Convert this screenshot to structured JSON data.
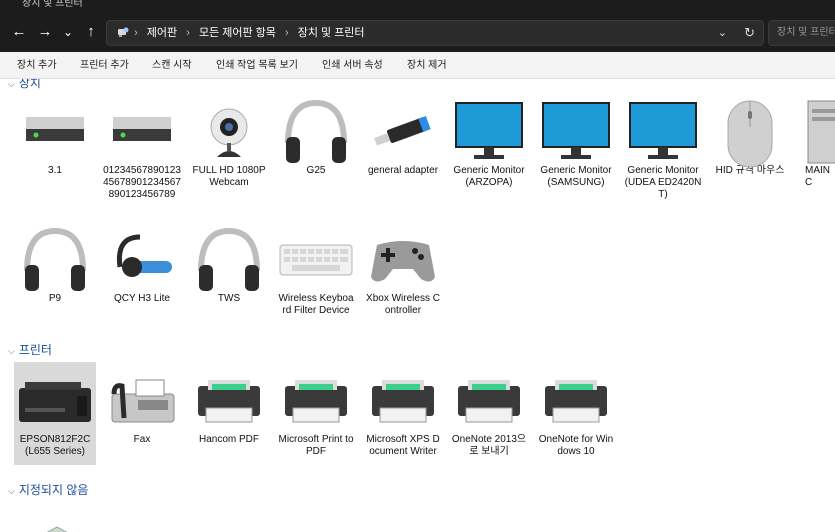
{
  "window": {
    "title": "장치 및 프린터"
  },
  "nav": {
    "back": "←",
    "forward": "→",
    "recent": "⌄",
    "up": "↑"
  },
  "address": {
    "crumbs": [
      "제어판",
      "모든 제어판 항목",
      "장치 및 프린터"
    ],
    "separator": "›",
    "dropdown": "⌄",
    "refresh": "↻"
  },
  "search": {
    "placeholder": "장치 및 프린터 검색"
  },
  "toolbar": {
    "add_device": "장치 추가",
    "add_printer": "프린터 추가",
    "start_scan": "스캔 시작",
    "print_queue": "인쇄 작업 목록 보기",
    "print_server": "인쇄 서버 속성",
    "remove_device": "장치 제거"
  },
  "groups": {
    "devices": "장치",
    "printers": "프린터",
    "unspecified": "지정되지 않음"
  },
  "devices": [
    {
      "label": "3.1",
      "icon": "drive-icon"
    },
    {
      "label": "0123456789012345678901234567890123456789",
      "icon": "drive-icon"
    },
    {
      "label": "FULL HD 1080P Webcam",
      "icon": "webcam-icon"
    },
    {
      "label": "G25",
      "icon": "headphones-icon"
    },
    {
      "label": "general adapter",
      "icon": "usb-adapter-icon"
    },
    {
      "label": "Generic Monitor (ARZOPA)",
      "icon": "monitor-icon"
    },
    {
      "label": "Generic Monitor (SAMSUNG)",
      "icon": "monitor-icon"
    },
    {
      "label": "Generic Monitor (UDEA ED2420NT)",
      "icon": "monitor-icon"
    },
    {
      "label": "HID 규격 마우스",
      "icon": "mouse-icon"
    },
    {
      "label": "MAINC",
      "icon": "computer-icon"
    },
    {
      "label": "P9",
      "icon": "headphones-icon"
    },
    {
      "label": "QCY H3 Lite",
      "icon": "headset-icon"
    },
    {
      "label": "TWS",
      "icon": "headphones-icon"
    },
    {
      "label": "Wireless Keyboard Filter Device",
      "icon": "keyboard-icon"
    },
    {
      "label": "Xbox Wireless Controller",
      "icon": "gamepad-icon"
    }
  ],
  "printers": [
    {
      "label": "EPSON812F2C (L655 Series)",
      "icon": "epson-printer-icon",
      "selected": true
    },
    {
      "label": "Fax",
      "icon": "fax-icon"
    },
    {
      "label": "Hancom PDF",
      "icon": "printer-icon"
    },
    {
      "label": "Microsoft Print to PDF",
      "icon": "printer-icon"
    },
    {
      "label": "Microsoft XPS Document Writer",
      "icon": "printer-icon"
    },
    {
      "label": "OneNote 2013으로 보내기",
      "icon": "printer-icon"
    },
    {
      "label": "OneNote for Windows 10",
      "icon": "printer-icon"
    }
  ],
  "colors": {
    "chrome": "#1c1c1c",
    "group_heading": "#1a4d9c",
    "selection": "#d9d9d9",
    "monitor_blue": "#1e9ad6",
    "printer_green": "#3ccf8e"
  }
}
